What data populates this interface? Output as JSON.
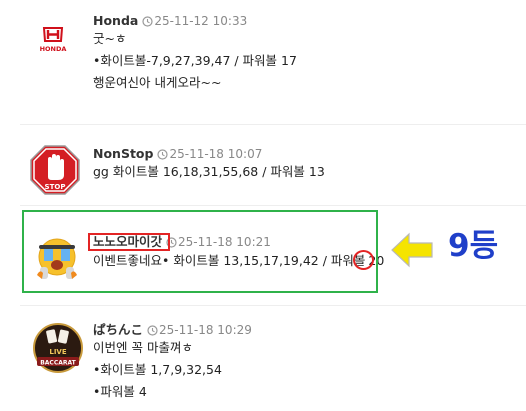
{
  "comments": [
    {
      "nickname": "Honda",
      "timestamp": "25-11-12 10:33",
      "avatar_text": "HONDA",
      "lines": [
        "굿~ㅎ",
        "•화이트볼-7,9,27,39,47 / 파워볼 17",
        "행운여신아 내게오라~~"
      ]
    },
    {
      "nickname": "NonStop",
      "timestamp": "25-11-18 10:07",
      "avatar_text": "STOP",
      "lines": [
        "gg 화이트볼 16,18,31,55,68 / 파워볼 13"
      ]
    },
    {
      "nickname": "노노오마이갓",
      "timestamp": "25-11-18 10:21",
      "avatar_icon": "crying-emoji-icon",
      "line_prefix": "이벤트좋네요• 화이트볼 13,15,17,19,42 / 파워볼",
      "line_number": "20"
    },
    {
      "nickname": "ぱちんこ",
      "timestamp": "25-11-18 10:29",
      "avatar_text_top": "LIVE",
      "avatar_text_bottom": "BACCARAT",
      "lines": [
        "이번엔 꼭 마출껴ㅎ",
        "•화이트볼 1,7,9,32,54",
        "•파워볼 4"
      ]
    }
  ],
  "annotation": {
    "rank_label": "9등",
    "highlight_color": "#2fb24a",
    "mark_color": "#e32424",
    "arrow_color": "#f5e400",
    "rank_color": "#1f3fc9"
  }
}
